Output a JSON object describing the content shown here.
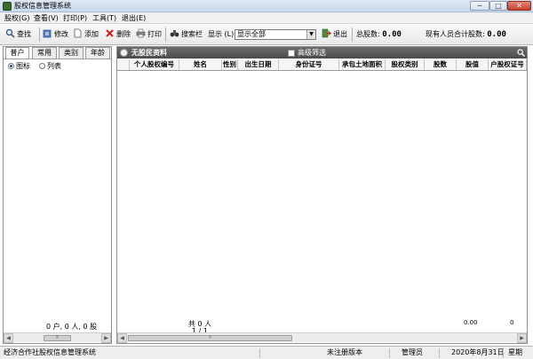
{
  "window": {
    "title": "股权信息管理系统",
    "controls": {
      "minimize": "─",
      "maximize": "□",
      "close": "✕"
    }
  },
  "menu": [
    {
      "label": "股权(G)"
    },
    {
      "label": "查看(V)"
    },
    {
      "label": "打印(P)"
    },
    {
      "label": "工具(T)"
    },
    {
      "label": "退出(E)"
    }
  ],
  "toolbar": {
    "query": "查找",
    "edit": "修改",
    "add": "添加",
    "delete": "删除",
    "print": "打印",
    "search_bar": "搜索栏",
    "display_label": "显示 (L):",
    "display_value": "显示全部",
    "exit": "退出",
    "total_shares_label": "总股数:",
    "total_shares_value": "0.00",
    "member_total_label": "现有人员合计股数:",
    "member_total_value": "0.00"
  },
  "left_panel": {
    "tabs": [
      "普户",
      "常用",
      "类别",
      "年龄"
    ],
    "active_tab": 0,
    "view_options": [
      "图标",
      "列表"
    ],
    "selected_view": 0,
    "count_text": "0 户, 0 人, 0 股"
  },
  "right_panel": {
    "header_title": "无股民资料",
    "advanced_filter": "高级筛选",
    "columns": [
      "个人股权编号",
      "姓名",
      "性别",
      "出生日期",
      "身份证号",
      "承包土地面积",
      "股权类别",
      "股数",
      "股值",
      "户股权证号"
    ],
    "footer_total": "共 0 人",
    "footer_page": "1 / 1",
    "sum_shares": "0.00",
    "sum_value": "0"
  },
  "statusbar": {
    "app_name": "经济合作社股权信息管理系统",
    "registration": "未注册版本",
    "user": "管理员",
    "date": "2020年8月31日",
    "weekday": "星期"
  },
  "colors": {
    "header_dark": "#4a4a4a",
    "title_gradient": "#c9d9ec",
    "close_red": "#c4402b"
  },
  "icons": {
    "query": "magnifier-icon",
    "edit": "pencil-icon",
    "add": "new-doc-icon",
    "delete": "red-x-icon",
    "print": "printer-icon",
    "search_bar": "binoculars-icon",
    "exit": "exit-icon"
  }
}
